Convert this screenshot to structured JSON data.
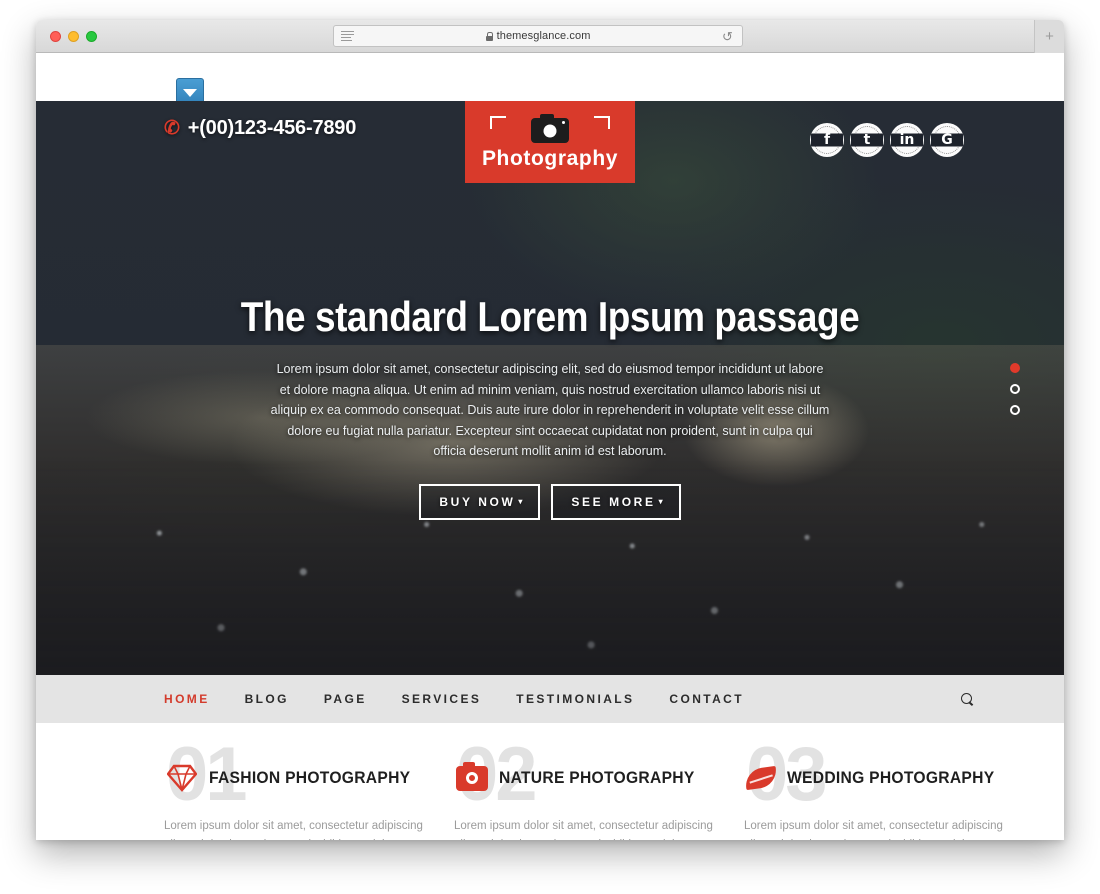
{
  "browser": {
    "url": "themesglance.com",
    "lock_icon": "lock-icon",
    "reader_icon": "reader-view-icon",
    "reload_icon": "reload-icon",
    "newtab_label": "+",
    "traffic_lights": [
      "close",
      "minimize",
      "maximize"
    ]
  },
  "toolbar_widget": {
    "dropdown_icon": "chevron-down-icon"
  },
  "header": {
    "phone": "+(00)123-456-7890",
    "phone_icon": "phone-icon",
    "logo_text": "Photography",
    "logo_icon": "camera-icon",
    "socials": [
      {
        "name": "facebook",
        "glyph": "f"
      },
      {
        "name": "twitter",
        "glyph": "t"
      },
      {
        "name": "linkedin",
        "glyph": "in"
      },
      {
        "name": "googleplus",
        "glyph": "G"
      }
    ]
  },
  "hero": {
    "title": "The standard Lorem Ipsum passage",
    "text": "Lorem ipsum dolor sit amet, consectetur adipiscing elit, sed do eiusmod tempor incididunt ut labore et dolore magna aliqua. Ut enim ad minim veniam, quis nostrud exercitation ullamco laboris nisi ut aliquip ex ea commodo consequat. Duis aute irure dolor in reprehenderit in voluptate velit esse cillum dolore eu fugiat nulla pariatur. Excepteur sint occaecat cupidatat non proident, sunt in culpa qui officia deserunt mollit anim id est laborum.",
    "buttons": [
      {
        "label": "BUY NOW",
        "caret": "▾"
      },
      {
        "label": "SEE MORE",
        "caret": "▾"
      }
    ],
    "slides": [
      {
        "active": true
      },
      {
        "active": false
      },
      {
        "active": false
      }
    ]
  },
  "nav": {
    "items": [
      {
        "label": "HOME",
        "active": true
      },
      {
        "label": "BLOG",
        "active": false
      },
      {
        "label": "PAGE",
        "active": false
      },
      {
        "label": "SERVICES",
        "active": false
      },
      {
        "label": "TESTIMONIALS",
        "active": false
      },
      {
        "label": "CONTACT",
        "active": false
      }
    ],
    "search_icon": "search-icon"
  },
  "services": [
    {
      "number": "01",
      "title": "FASHION PHOTOGRAPHY",
      "icon": "diamond-icon",
      "desc": "Lorem ipsum dolor sit amet, consectetur adipiscing elit, sed do eiusmod tempor incididunt ut labore et"
    },
    {
      "number": "02",
      "title": "NATURE PHOTOGRAPHY",
      "icon": "camera-icon",
      "desc": "Lorem ipsum dolor sit amet, consectetur adipiscing elit, sed do eiusmod tempor incididunt ut labore et"
    },
    {
      "number": "03",
      "title": "WEDDING PHOTOGRAPHY",
      "icon": "leaf-icon",
      "desc": "Lorem ipsum dolor sit amet, consectetur adipiscing elit, sed do eiusmod tempor incididunt ut labore et"
    }
  ],
  "colors": {
    "brand_red": "#d93a2b",
    "hero_dark": "#262c35",
    "nav_bg": "#e4e4e4",
    "number_grey": "#e2e2e2"
  }
}
